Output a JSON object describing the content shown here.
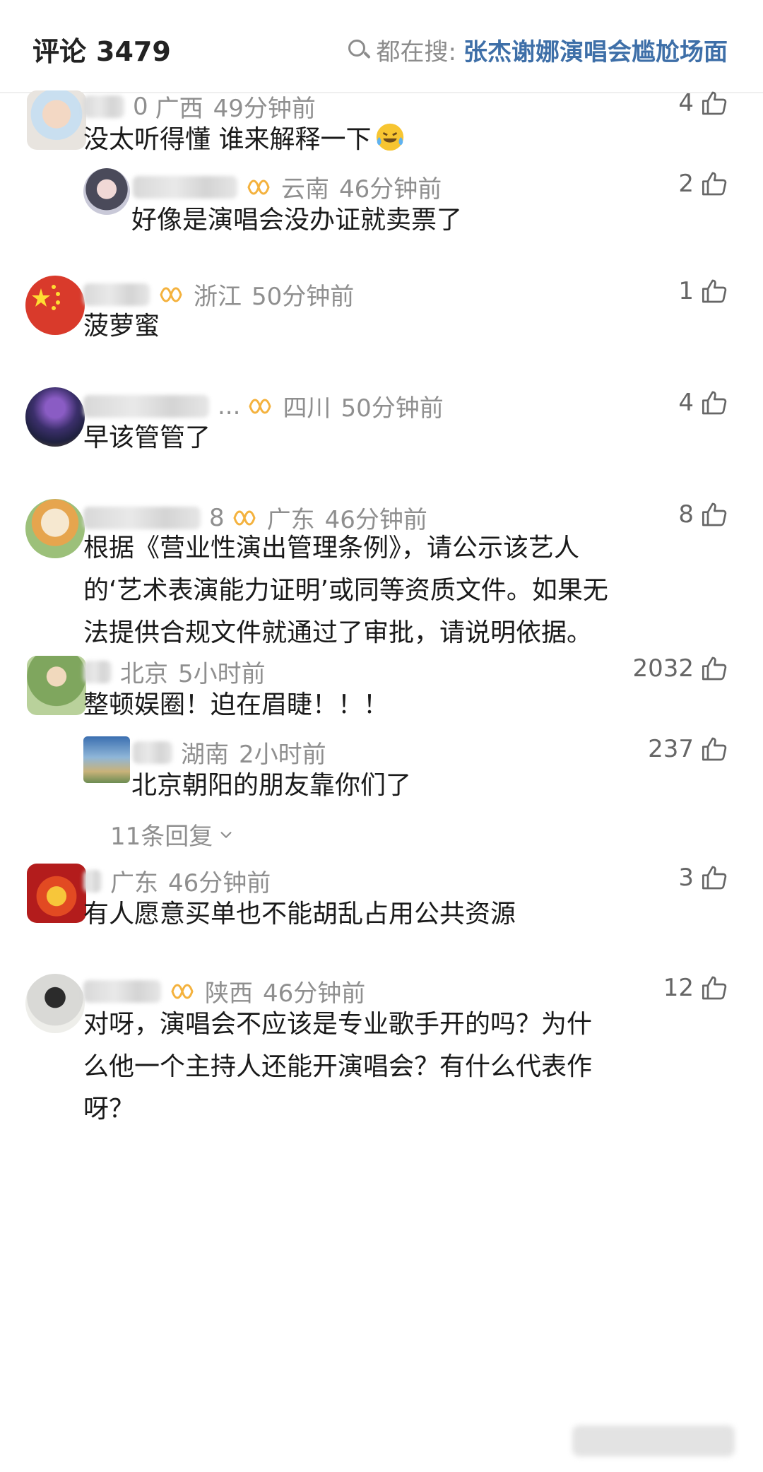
{
  "header": {
    "title": "评论",
    "count": "3479",
    "hot_search_prefix": "都在搜:",
    "hot_search_query": "张杰谢娜演唱会尴尬场面"
  },
  "colors": {
    "accent": "#3e6fa8",
    "meta": "#8f8f8f",
    "vip": "#f4b23e"
  },
  "comments": [
    {
      "name_suffix": "0",
      "region": "广西",
      "time": "49分钟前",
      "likes": "4",
      "text": "没太听得懂    谁来解释一下",
      "reply": {
        "region": "云南",
        "time": "46分钟前",
        "likes": "2",
        "text": "好像是演唱会没办证就卖票了"
      }
    },
    {
      "region": "浙江",
      "time": "50分钟前",
      "likes": "1",
      "text": "菠萝蜜"
    },
    {
      "name_suffix": "...",
      "region": "四川",
      "time": "50分钟前",
      "likes": "4",
      "text": "早该管管了"
    },
    {
      "name_suffix": "8",
      "region": "广东",
      "time": "46分钟前",
      "likes": "8",
      "text_lines": [
        "根据《营业性演出管理条例》，请公示该艺人",
        "的‘艺术表演能力证明’或同等资质文件。如果无",
        "法提供合规文件就通过了审批，请说明依据。"
      ]
    },
    {
      "region": "北京",
      "time": "5小时前",
      "likes": "2032",
      "text": "整顿娱圈！迫在眉睫！！！",
      "reply": {
        "region": "湖南",
        "time": "2小时前",
        "likes": "237",
        "text": "北京朝阳的朋友靠你们了"
      },
      "more_replies": "11条回复"
    },
    {
      "region": "广东",
      "time": "46分钟前",
      "likes": "3",
      "text": "有人愿意买单也不能胡乱占用公共资源"
    },
    {
      "region": "陕西",
      "time": "46分钟前",
      "likes": "12",
      "text_lines": [
        "对呀，演唱会不应该是专业歌手开的吗？为什",
        "么他一个主持人还能开演唱会？有什么代表作",
        "呀？"
      ]
    }
  ]
}
